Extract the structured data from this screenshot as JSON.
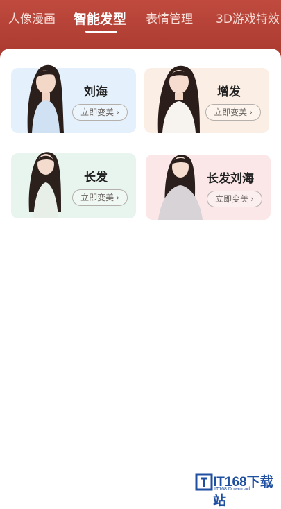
{
  "tabs": [
    {
      "label": "人像漫画"
    },
    {
      "label": "智能发型",
      "active": true
    },
    {
      "label": "表情管理"
    },
    {
      "label": "3D游戏特效"
    }
  ],
  "cards": [
    {
      "title": "刘海",
      "cta": "立即变美",
      "bg": "#e4f0fb"
    },
    {
      "title": "增发",
      "cta": "立即变美",
      "bg": "#fbeee4"
    },
    {
      "title": "长发",
      "cta": "立即变美",
      "bg": "#e8f4ee"
    },
    {
      "title": "长发刘海",
      "cta": "立即变美",
      "bg": "#fbe6e8"
    }
  ],
  "icons": {
    "cta_arrow": "chevron-right-icon"
  },
  "watermark": {
    "text": "IT168下载站",
    "sub": "IT168 Download"
  },
  "colors": {
    "header": "#b2423a",
    "tab_active": "#ffffff",
    "tab_inactive": "#f6dcd6"
  }
}
